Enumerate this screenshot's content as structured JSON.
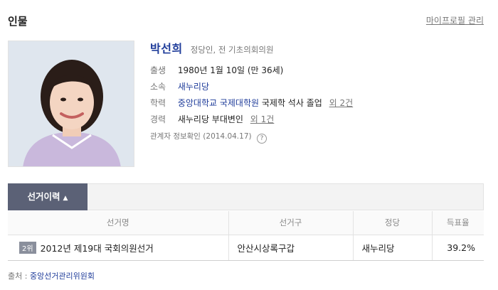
{
  "header": {
    "title": "인물",
    "profile_manage_link": "마이프로필 관리"
  },
  "person": {
    "name": "박선희",
    "description": "정당인, 전 기초의회의원",
    "info": [
      {
        "label": "출생",
        "value": "1980년 1월 10일 (만 36세)"
      },
      {
        "label": "소속",
        "value": "새누리당"
      },
      {
        "label": "학력",
        "value_link": "중앙대학교 국제대학원",
        "value_text": "국제학 석사 졸업",
        "more": "외 2건"
      },
      {
        "label": "경력",
        "value": "새누리당 부대변인",
        "more": "외 1건"
      }
    ],
    "verification": "관계자 정보확인 (2014.04.17)",
    "help_icon_text": "?"
  },
  "tabs": {
    "active_label": "선거이력",
    "caret": "▲"
  },
  "table": {
    "headers": [
      "선거명",
      "선거구",
      "정당",
      "득표율"
    ],
    "rows": [
      {
        "rank": "2위",
        "election": "2012년 제19대 국회의원선거",
        "district": "안산시상록구갑",
        "party": "새누리당",
        "vote_rate": "39.2%"
      }
    ]
  },
  "source": {
    "label": "출처 :",
    "link": "중앙선거관리위원회"
  },
  "colors": {
    "accent": "#1f3c9a",
    "tab_bg": "#5b6176"
  }
}
